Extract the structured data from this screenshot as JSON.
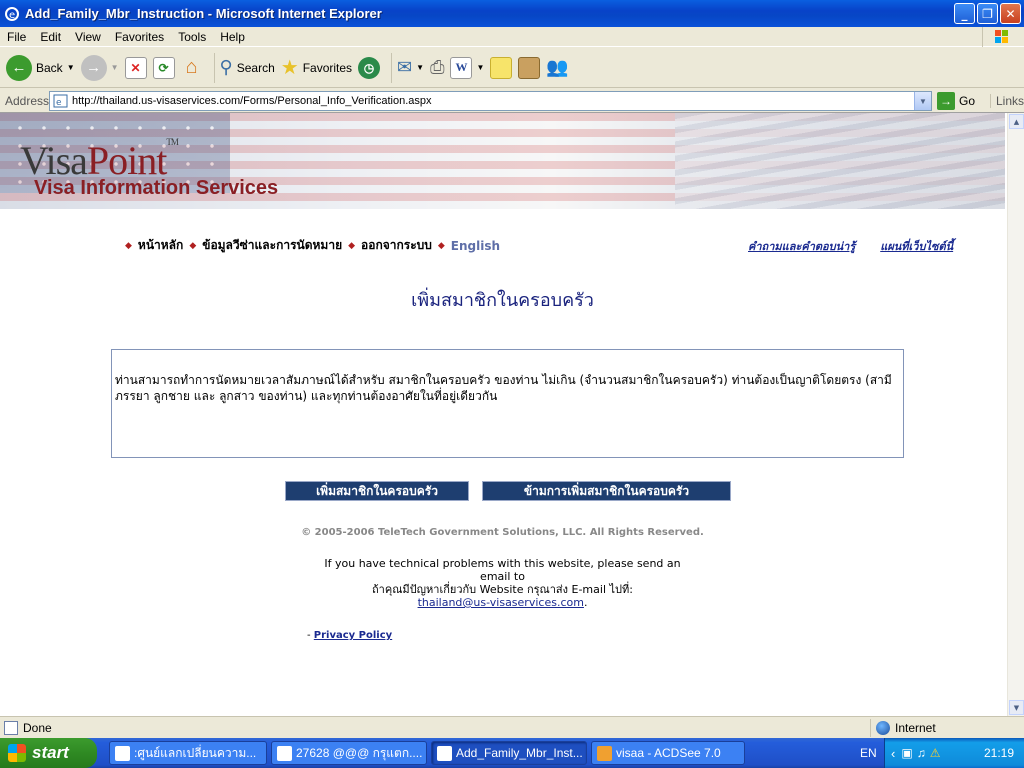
{
  "window": {
    "title": "Add_Family_Mbr_Instruction - Microsoft Internet Explorer"
  },
  "menu": [
    "File",
    "Edit",
    "View",
    "Favorites",
    "Tools",
    "Help"
  ],
  "toolbar": {
    "back_label": "Back",
    "search_label": "Search",
    "favorites_label": "Favorites"
  },
  "address": {
    "label": "Address",
    "url": "http://thailand.us-visaservices.com/Forms/Personal_Info_Verification.aspx",
    "go_label": "Go",
    "links_label": "Links"
  },
  "site": {
    "logo_visa": "Visa",
    "logo_point": "Point",
    "logo_tm": "TM",
    "logo_sub": "Visa Information Services",
    "nav": [
      "หน้าหลัก",
      "ข้อมูลวีซ่าและการนัดหมาย",
      "ออกจากระบบ",
      "English"
    ],
    "top_links": [
      "คำถามและคำตอบน่ารู้",
      "แผนที่เว็บไซต์นี้"
    ]
  },
  "content": {
    "heading": "เพิ่มสมาชิกในครอบครัว",
    "instruction": "ท่านสามารถทำการนัดหมายเวลาสัมภาษณ์ได้สำหรับ สมาชิกในครอบครัว ของท่าน ไม่เกิน (จำนวนสมาชิกในครอบครัว)  ท่านต้องเป็นญาติโดยตรง (สามี ภรรยา ลูกชาย และ ลูกสาว ของท่าน)  และทุกท่านต้องอาศัยในที่อยู่เดียวกัน",
    "add_button": "เพิ่มสมาชิกในครอบครัว",
    "skip_button": "ข้ามการเพิ่มสมาชิกในครอบครัว"
  },
  "footer": {
    "copyright": "© 2005-2006 TeleTech Government Solutions, LLC. All Rights Reserved.",
    "tech_en": "If you have technical problems with this website, please send an email to",
    "tech_th": "ถ้าคุณมีปัญหาเกี่ยวกับ Website กรุณาส่ง E-mail ไปที่:",
    "email": "thailand@us-visaservices.com",
    "email_suffix": ".",
    "privacy_bullet": "-",
    "privacy": "Privacy Policy"
  },
  "status": {
    "text": "Done",
    "zone": "Internet"
  },
  "taskbar": {
    "start": "start",
    "tasks": [
      {
        "label": ":ศูนย์แลกเปลี่ยนความ...",
        "active": false
      },
      {
        "label": "27628 @@@ กรุแตก....",
        "active": false
      },
      {
        "label": "Add_Family_Mbr_Inst...",
        "active": true
      },
      {
        "label": "visaa - ACDSee 7.0",
        "active": false
      }
    ],
    "lang": "EN",
    "clock": "21:19"
  }
}
